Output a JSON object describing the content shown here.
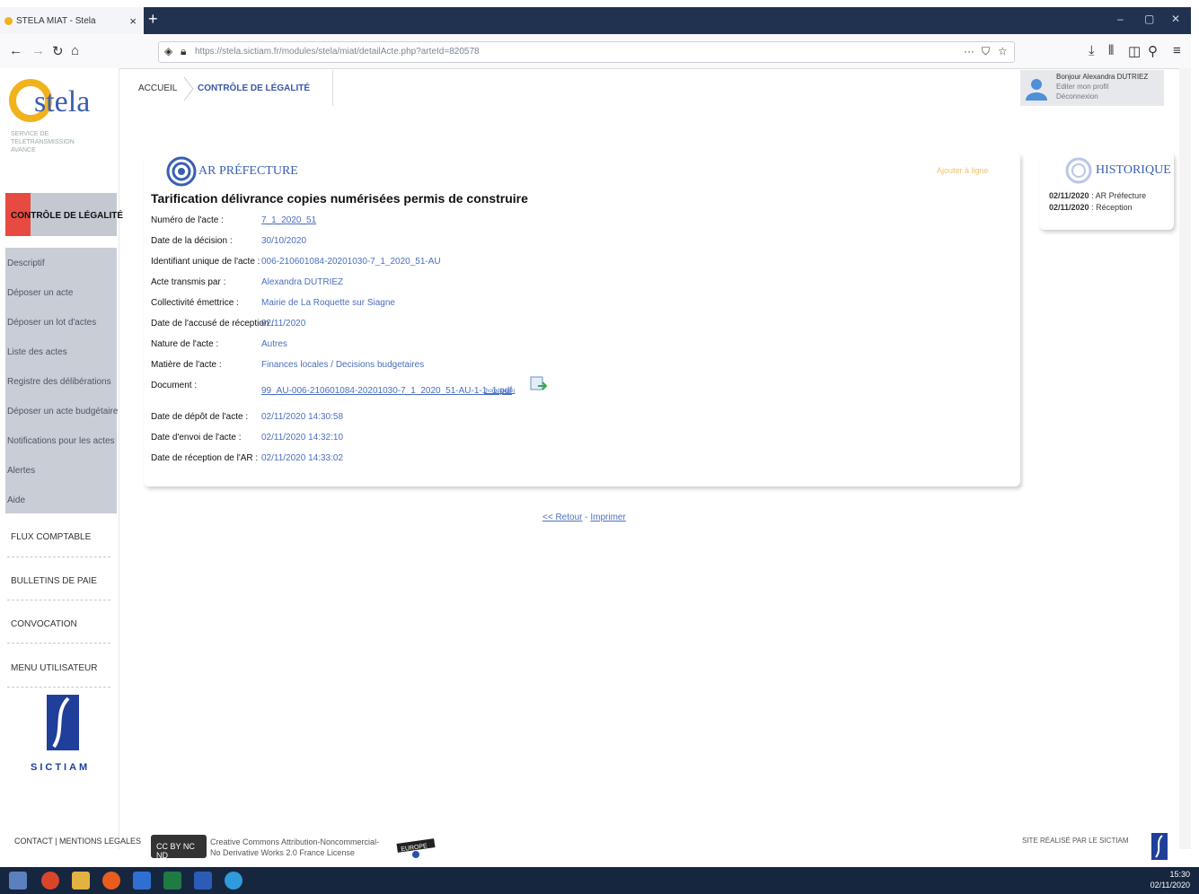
{
  "browser": {
    "tab_title": "STELA MIAT - Stela",
    "tab_close": "×",
    "new_tab": "+",
    "url": "https://stela.sictiam.fr/modules/stela/miat/detailActe.php?arteId=820578",
    "window_controls": [
      "–",
      "▢",
      "✕"
    ]
  },
  "sidebar": {
    "logo_text": "stela",
    "logo_subtitle": "SERVICE DE TELETRANSMISSION AVANCE",
    "section_active": "CONTRÔLE DE LÉGALITÉ",
    "submenu": [
      "Descriptif",
      "Déposer un acte",
      "Déposer un lot d'actes",
      "Liste des actes",
      "Registre des délibérations",
      "Déposer un acte budgétaire",
      "Notifications pour les actes",
      "Alertes",
      "Aide"
    ],
    "main_items": [
      "FLUX COMPTABLE",
      "BULLETINS DE PAIE",
      "CONVOCATION",
      "MENU UTILISATEUR"
    ],
    "partner_logo_text": "SICTIAM"
  },
  "header": {
    "breadcrumb_home": "ACCUEIL",
    "breadcrumb_current": "CONTRÔLE DE LÉGALITÉ",
    "user_greeting": "Bonjour Alexandra DUTRIEZ",
    "user_edit": "Editer mon profil",
    "user_logout": "Déconnexion"
  },
  "acte": {
    "section_title": "AR PRÉFECTURE",
    "print_link": "Ajouter à ligne",
    "title": "Tarification délivrance copies numérisées permis de construire",
    "fields": [
      {
        "label": "Numéro de l'acte :",
        "value": "7_1_2020_51"
      },
      {
        "label": "Date de la décision :",
        "value": "30/10/2020"
      },
      {
        "label": "Identifiant unique de l'acte :",
        "value": "006-210601084-20201030-7_1_2020_51-AU"
      },
      {
        "label": "Acte transmis par :",
        "value": "Alexandra DUTRIEZ"
      },
      {
        "label": "Collectivité émettrice :",
        "value": "Mairie de La Roquette sur Siagne"
      },
      {
        "label": "Date de l'accusé de réception :",
        "value": "02/11/2020"
      },
      {
        "label": "Nature de l'acte :",
        "value": "Autres"
      },
      {
        "label": "Matière de l'acte :",
        "value": "Finances locales / Decisions budgetaires"
      },
      {
        "label": "Document :",
        "value": "99_AU-006-210601084-20201030-7_1_2020_51-AU-1-1_1.pdf"
      },
      {
        "label": "Date de dépôt de l'acte :",
        "value": "02/11/2020 14:30:58"
      },
      {
        "label": "Date d'envoi de l'acte :",
        "value": "02/11/2020 14:32:10"
      },
      {
        "label": "Date de réception de l'AR :",
        "value": "02/11/2020 14:33:02"
      }
    ],
    "document_note": "(horodatage)",
    "back_link": "<< Retour",
    "separator": " - ",
    "print_action": "Imprimer"
  },
  "historique": {
    "title": "HISTORIQUE",
    "entries": [
      {
        "date": "02/11/2020",
        "event": " : AR Préfecture"
      },
      {
        "date": "02/11/2020",
        "event": " : Réception"
      }
    ]
  },
  "footer": {
    "links": "CONTACT | MENTIONS LEGALES",
    "cc_badge": "CC BY NC ND",
    "license_line1": "Creative Commons Attribution-Noncommercial-",
    "license_line2": "No Derivative Works 2.0 France License",
    "euro_label": "EUROPE",
    "credit": "SITE RÉALISÉ PAR LE SICTIAM"
  },
  "taskbar": {
    "time": "15:30",
    "date": "02/11/2020"
  },
  "colors": {
    "accent": "#3a5fb0",
    "link": "#4a6fc0",
    "active_marker": "#e64a40",
    "taskbar": "#16263f"
  }
}
